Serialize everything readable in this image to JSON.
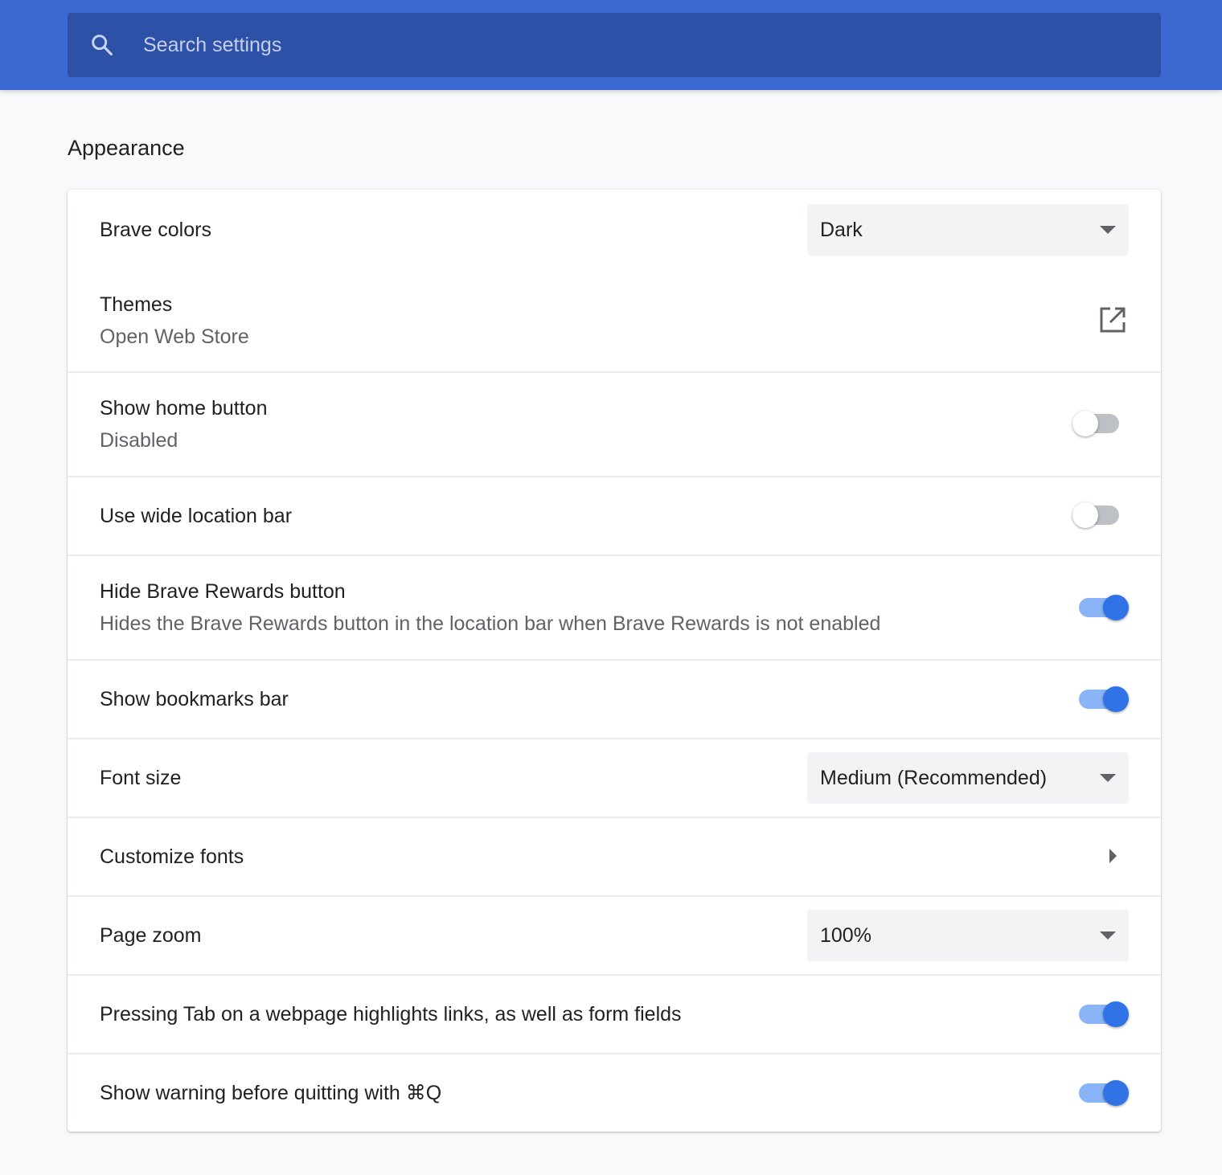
{
  "search": {
    "placeholder": "Search settings",
    "value": ""
  },
  "section": {
    "title": "Appearance"
  },
  "settings": {
    "brave_colors": {
      "label": "Brave colors",
      "value": "Dark"
    },
    "themes": {
      "label": "Themes",
      "sublabel": "Open Web Store",
      "icon": "open-in-new-icon"
    },
    "show_home_button": {
      "label": "Show home button",
      "sublabel": "Disabled",
      "enabled": false
    },
    "wide_location_bar": {
      "label": "Use wide location bar",
      "enabled": false
    },
    "hide_rewards_button": {
      "label": "Hide Brave Rewards button",
      "sublabel": "Hides the Brave Rewards button in the location bar when Brave Rewards is not enabled",
      "enabled": true
    },
    "show_bookmarks_bar": {
      "label": "Show bookmarks bar",
      "enabled": true
    },
    "font_size": {
      "label": "Font size",
      "value": "Medium (Recommended)"
    },
    "customize_fonts": {
      "label": "Customize fonts",
      "icon": "chevron-right-icon"
    },
    "page_zoom": {
      "label": "Page zoom",
      "value": "100%"
    },
    "tab_highlights": {
      "label": "Pressing Tab on a webpage highlights links, as well as form fields",
      "enabled": true
    },
    "quit_warning": {
      "label": "Show warning before quitting with ⌘Q",
      "enabled": true
    }
  },
  "colors": {
    "header_bg": "#3c69d2",
    "search_bg": "#2d51a6",
    "toggle_on": "#2f73e6",
    "toggle_on_track": "#8ab4f8",
    "toggle_off_track": "#bdc1c6"
  }
}
